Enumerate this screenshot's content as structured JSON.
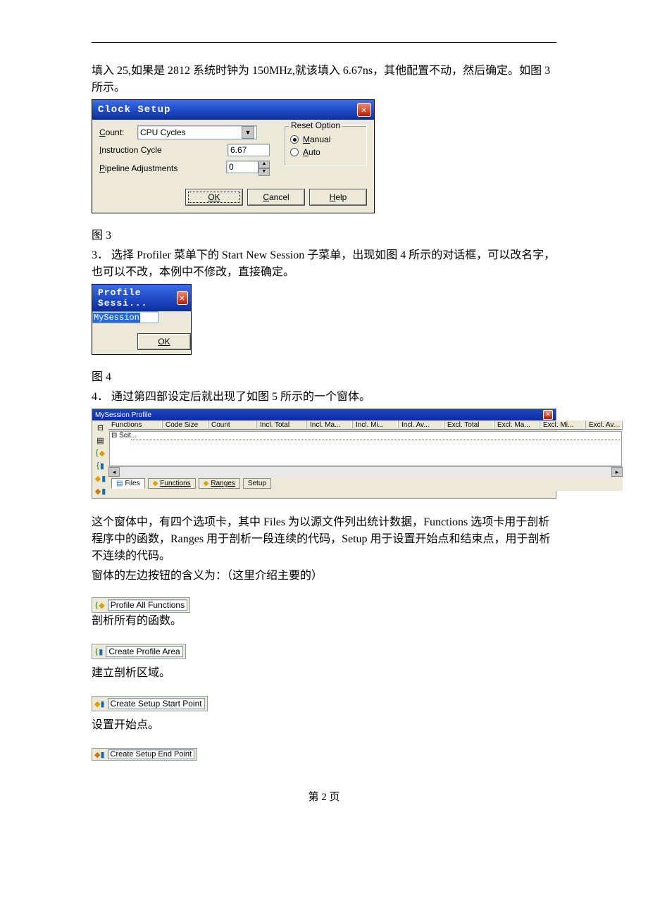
{
  "text": {
    "intro1": "填入 25,如果是 2812 系统时钟为 150MHz,就该填入 6.67ns，其他配置不动，然后确定。如图 3 所示。",
    "fig3": "图 3",
    "step3": "3．  选择 Profiler 菜单下的 Start New Session 子菜单，出现如图 4 所示的对话框，可以改名字，也可以不改，本例中不修改，直接确定。",
    "fig4": "图 4",
    "step4": "4．  通过第四部设定后就出现了如图 5 所示的一个窗体。",
    "after5a": "这个窗体中，有四个选项卡，其中 Files 为以源文件列出统计数据，Functions 选项卡用于剖析程序中的函数，Ranges 用于剖析一段连续的代码，Setup 用于设置开始点和结束点，用于剖析不连续的代码。",
    "after5b": "窗体的左边按钮的含义为：（这里介绍主要的）",
    "desc1": "剖析所有的函数。",
    "desc2": "建立剖析区域。",
    "desc3": "设置开始点。",
    "footer": "第 2 页"
  },
  "clock_dialog": {
    "title": "Clock Setup",
    "count_label": "Count:",
    "count_value": "CPU Cycles",
    "instr_label": "Instruction Cycle",
    "instr_value": "6.67",
    "pipeline_label": "Pipeline Adjustments",
    "pipeline_value": "0",
    "reset_legend": "Reset Option",
    "manual": "Manual",
    "auto": "Auto",
    "ok": "OK",
    "cancel": "Cancel",
    "help": "Help"
  },
  "session_dialog": {
    "title": "Profile Sessi...",
    "value": "MySession",
    "ok": "OK"
  },
  "profile_win": {
    "title": "MySession Profile",
    "cols": [
      "Functions",
      "Code Size",
      "Count",
      "Incl. Total",
      "Incl. Ma...",
      "Incl. Mi...",
      "Incl. Av...",
      "Excl. Total",
      "Excl. Ma...",
      "Excl. Mi...",
      "Excl. Av..."
    ],
    "row0": "⊟ Scit...",
    "tabs": {
      "files": "Files",
      "functions": "Functions",
      "ranges": "Ranges",
      "setup": "Setup"
    }
  },
  "tools": {
    "t1": "Profile All Functions",
    "t2": "Create Profile Area",
    "t3": "Create Setup Start Point",
    "t4": "Create Setup End Point"
  }
}
